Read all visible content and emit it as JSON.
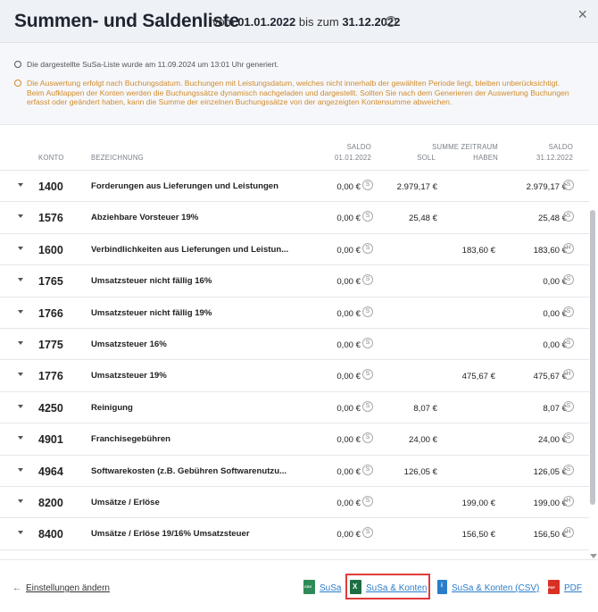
{
  "dialog": {
    "title": "Summen- und Saldenliste",
    "period_prefix": "vom",
    "period_start": "01.01.2022",
    "period_mid": "bis zum",
    "period_end": "31.12.2022",
    "help_icon": "?",
    "close_icon": "×"
  },
  "info": {
    "generated": "Die dargestellte SuSa-Liste wurde am 11.09.2024 um 13:01 Uhr generiert.",
    "note": "Die Auswertung erfolgt nach Buchungsdatum. Buchungen mit Leistungsdatum, welches nicht innerhalb der gewählten Periode liegt, bleiben unberücksichtigt. Beim Aufklappen der Konten werden die Buchungssätze dynamisch nachgeladen und dargestellt. Sollten Sie nach dem Generieren der Auswertung Buchungen erfasst oder geändert haben, kann die Summe der einzelnen Buchungssätze von der angezeigten Kontensumme abweichen."
  },
  "columns": {
    "konto": "KONTO",
    "bezeichnung": "BEZEICHNUNG",
    "saldo_start_top": "SALDO",
    "saldo_start_bottom": "01.01.2022",
    "summe_top": "SUMME ZEITRAUM",
    "soll": "SOLL",
    "haben": "HABEN",
    "saldo_end_top": "SALDO",
    "saldo_end_bottom": "31.12.2022"
  },
  "rows": [
    {
      "konto": "1400",
      "bez": "Forderungen aus Lieferungen und Leistungen",
      "saldo1": "0,00 €",
      "b1": "S",
      "soll": "2.979,17 €",
      "haben": "",
      "saldo2": "2.979,17 €",
      "b2": "S"
    },
    {
      "konto": "1576",
      "bez": "Abziehbare Vorsteuer 19%",
      "saldo1": "0,00 €",
      "b1": "S",
      "soll": "25,48 €",
      "haben": "",
      "saldo2": "25,48 €",
      "b2": "S"
    },
    {
      "konto": "1600",
      "bez": "Verbindlichkeiten aus Lieferungen und Leistun...",
      "saldo1": "0,00 €",
      "b1": "S",
      "soll": "",
      "haben": "183,60 €",
      "saldo2": "183,60 €",
      "b2": "H"
    },
    {
      "konto": "1765",
      "bez": "Umsatzsteuer nicht fällig 16%",
      "saldo1": "0,00 €",
      "b1": "S",
      "soll": "",
      "haben": "",
      "saldo2": "0,00 €",
      "b2": "S"
    },
    {
      "konto": "1766",
      "bez": "Umsatzsteuer nicht fällig 19%",
      "saldo1": "0,00 €",
      "b1": "S",
      "soll": "",
      "haben": "",
      "saldo2": "0,00 €",
      "b2": "S"
    },
    {
      "konto": "1775",
      "bez": "Umsatzsteuer 16%",
      "saldo1": "0,00 €",
      "b1": "S",
      "soll": "",
      "haben": "",
      "saldo2": "0,00 €",
      "b2": "S"
    },
    {
      "konto": "1776",
      "bez": "Umsatzsteuer 19%",
      "saldo1": "0,00 €",
      "b1": "S",
      "soll": "",
      "haben": "475,67 €",
      "saldo2": "475,67 €",
      "b2": "H"
    },
    {
      "konto": "4250",
      "bez": "Reinigung",
      "saldo1": "0,00 €",
      "b1": "S",
      "soll": "8,07 €",
      "haben": "",
      "saldo2": "8,07 €",
      "b2": "S"
    },
    {
      "konto": "4901",
      "bez": "Franchisegebühren",
      "saldo1": "0,00 €",
      "b1": "S",
      "soll": "24,00 €",
      "haben": "",
      "saldo2": "24,00 €",
      "b2": "S"
    },
    {
      "konto": "4964",
      "bez": "Softwarekosten (z.B. Gebühren Softwarenutzu...",
      "saldo1": "0,00 €",
      "b1": "S",
      "soll": "126,05 €",
      "haben": "",
      "saldo2": "126,05 €",
      "b2": "S"
    },
    {
      "konto": "8200",
      "bez": "Umsätze / Erlöse",
      "saldo1": "0,00 €",
      "b1": "S",
      "soll": "",
      "haben": "199,00 €",
      "saldo2": "199,00 €",
      "b2": "H"
    },
    {
      "konto": "8400",
      "bez": "Umsätze / Erlöse 19/16% Umsatzsteuer",
      "saldo1": "0,00 €",
      "b1": "S",
      "soll": "",
      "haben": "156,50 €",
      "saldo2": "156,50 €",
      "b2": "H"
    }
  ],
  "footer": {
    "back_label": "Einstellungen ändern",
    "back_arrow": "←",
    "export_susa": "SuSa",
    "export_susa_konten": "SuSa & Konten",
    "export_susa_konten_csv": "SuSa & Konten (CSV)",
    "export_pdf": "PDF"
  },
  "colors": {
    "header_bg": "#eef1f5",
    "info_warning": "#d08c2b",
    "link_blue": "#2a7dc9",
    "highlight_red": "#e03b3b"
  }
}
